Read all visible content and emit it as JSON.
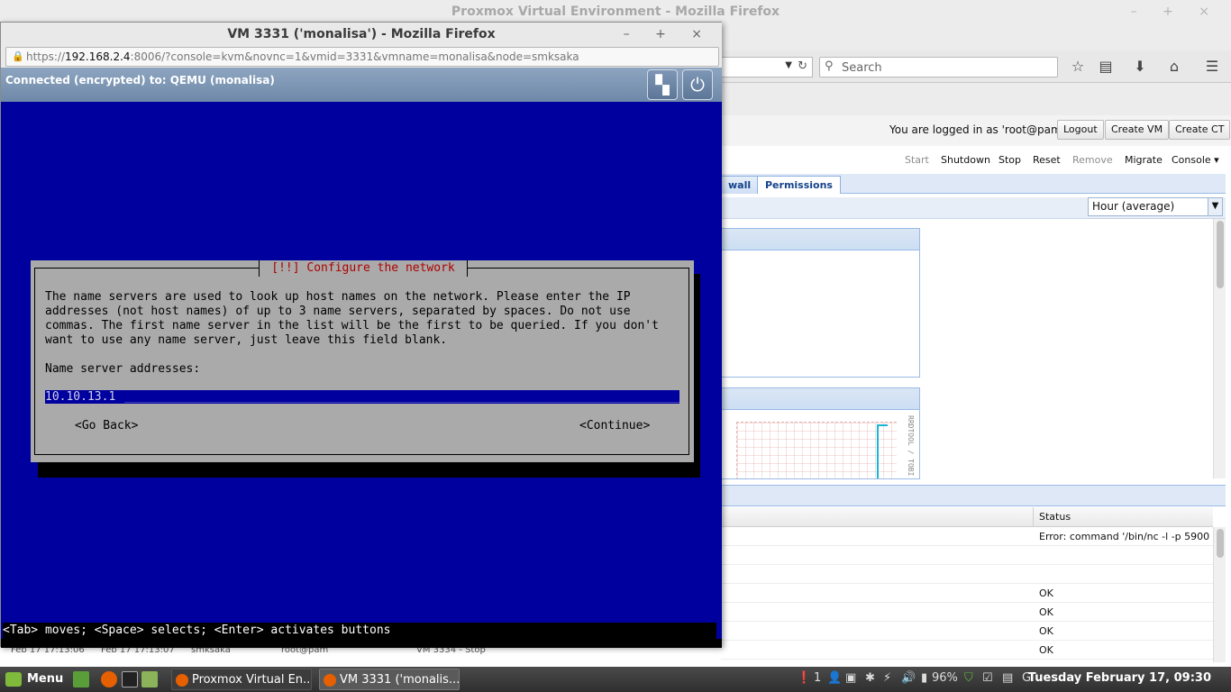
{
  "background_window": {
    "title": "Proxmox Virtual Environment - Mozilla Firefox",
    "search_placeholder": "Search",
    "logged_in_text": "You are logged in as 'root@pam'",
    "header_buttons": [
      "Logout",
      "Create VM",
      "Create CT"
    ],
    "vm_actions": [
      "Start",
      "Shutdown",
      "Stop",
      "Reset",
      "Remove",
      "Migrate",
      "Console"
    ],
    "tabs": [
      "wall",
      "Permissions"
    ],
    "timeframe_select": "Hour (average)",
    "graph_label": "RRDTOOL / TOBI",
    "log": {
      "status_header": "Status",
      "rows": [
        "Error: command '/bin/nc -l -p 5900 -...",
        "",
        "",
        "OK",
        "OK",
        "OK",
        "OK"
      ],
      "peek_row": [
        "Feb 17 17:13:06",
        "Feb 17 17:13:07",
        "smksaka",
        "root@pam",
        "VM 3334 - Stop"
      ]
    }
  },
  "popup": {
    "title": "VM 3331 ('monalisa') - Mozilla Firefox",
    "url_prefix": "https://",
    "url_host": "192.168.2.4",
    "url_rest": ":8006/?console=kvm&novnc=1&vmid=3331&vmname=monalisa&node=smksaka",
    "novnc_status": "Connected (encrypted) to: QEMU (monalisa)",
    "installer": {
      "dialog_title": "[!!] Configure the network",
      "body": "The name servers are used to look up host names on the network. Please enter the IP\naddresses (not host names) of up to 3 name servers, separated by spaces. Do not use\ncommas. The first name server in the list will be the first to be queried. If you don't\nwant to use any name server, just leave this field blank.",
      "field_label": "Name server addresses:",
      "field_value": "10.10.13.1",
      "go_back": "<Go Back>",
      "continue": "<Continue>",
      "hint": "<Tab> moves; <Space> selects; <Enter> activates buttons"
    }
  },
  "taskbar": {
    "menu_label": "Menu",
    "tasks": [
      "Proxmox Virtual En...",
      "VM 3331 ('monalis..."
    ],
    "tray_count": "1",
    "battery": "96%",
    "clock": "Tuesday February 17, 09:30"
  }
}
